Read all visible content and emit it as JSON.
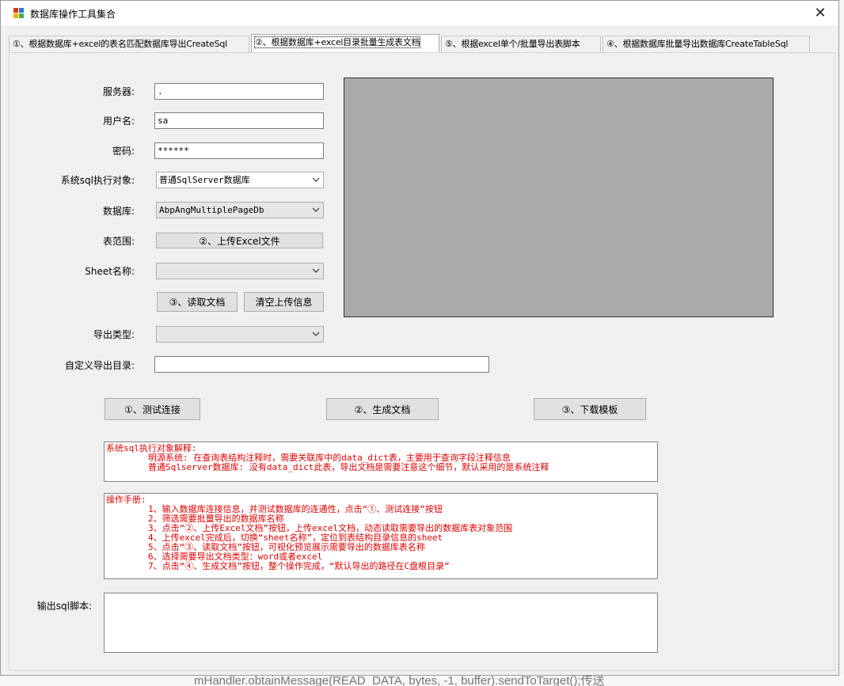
{
  "window": {
    "title": "数据库操作工具集合"
  },
  "tabs": [
    {
      "label": "①、根据数据库+excel的表名匹配数据库导出CreateSql"
    },
    {
      "label": "②、根据数据库+excel目录批量生成表文档"
    },
    {
      "label": "⑤、根据excel单个/批量导出表脚本"
    },
    {
      "label": "④、根据数据库批量导出数据库CreateTableSql"
    }
  ],
  "form": {
    "server_label": "服务器:",
    "server_value": ".",
    "user_label": "用户名:",
    "user_value": "sa",
    "password_label": "密码:",
    "password_value": "******",
    "sql_target_label": "系统sql执行对象:",
    "sql_target_value": "普通SqlServer数据库",
    "database_label": "数据库:",
    "database_value": "AbpAngMultiplePageDb",
    "table_range_label": "表范围:",
    "upload_excel_button": "②、上传Excel文件",
    "sheet_label": "Sheet名称:",
    "sheet_value": "",
    "read_doc_button": "③、读取文档",
    "clear_upload_button": "清空上传信息",
    "export_type_label": "导出类型:",
    "export_type_value": "",
    "custom_dir_label": "自定义导出目录:",
    "custom_dir_value": ""
  },
  "actions": {
    "test_connection": "①、测试连接",
    "generate_doc": "②、生成文档",
    "download_template": "③、下载模板"
  },
  "sql_target_explain": {
    "text": "系统sql执行对象解释:\n        明源系统: 在查询表结构注释时，需要关联库中的data_dict表，主要用于查询字段注释信息\n        普通Sqlserver数据库: 没有data_dict此表，导出文档是需要注意这个细节，默认采用的是系统注释"
  },
  "manual": {
    "text": "操作手册:\n        1、输入数据库连接信息，并测试数据库的连通性，点击“①、测试连接”按钮\n        2、筛选需要批量导出的数据库名称\n        3、点击“②、上传Excel文档”按钮，上传excel文档，动态读取需要导出的数据库表对象范围\n        4、上传excel完成后，切换“sheet名称”，定位到表结构目录信息的sheet\n        5、点击“③、读取文档”按钮，可视化预览展示需要导出的数据库表名称\n        6、选择需要导出文档类型：word或者excel\n        7、点击“④、生成文档”按钮，整个操作完成，“默认导出的路径在C盘根目录”"
  },
  "output": {
    "label": "输出sql脚本:",
    "value": ""
  },
  "background": {
    "bottom_text": "mHandler.obtainMessage(READ_DATA, bytes, -1, buffer).sendToTarget();传送"
  },
  "colors": {
    "memo_text": "#e00000",
    "preview_bg": "#ababab"
  }
}
